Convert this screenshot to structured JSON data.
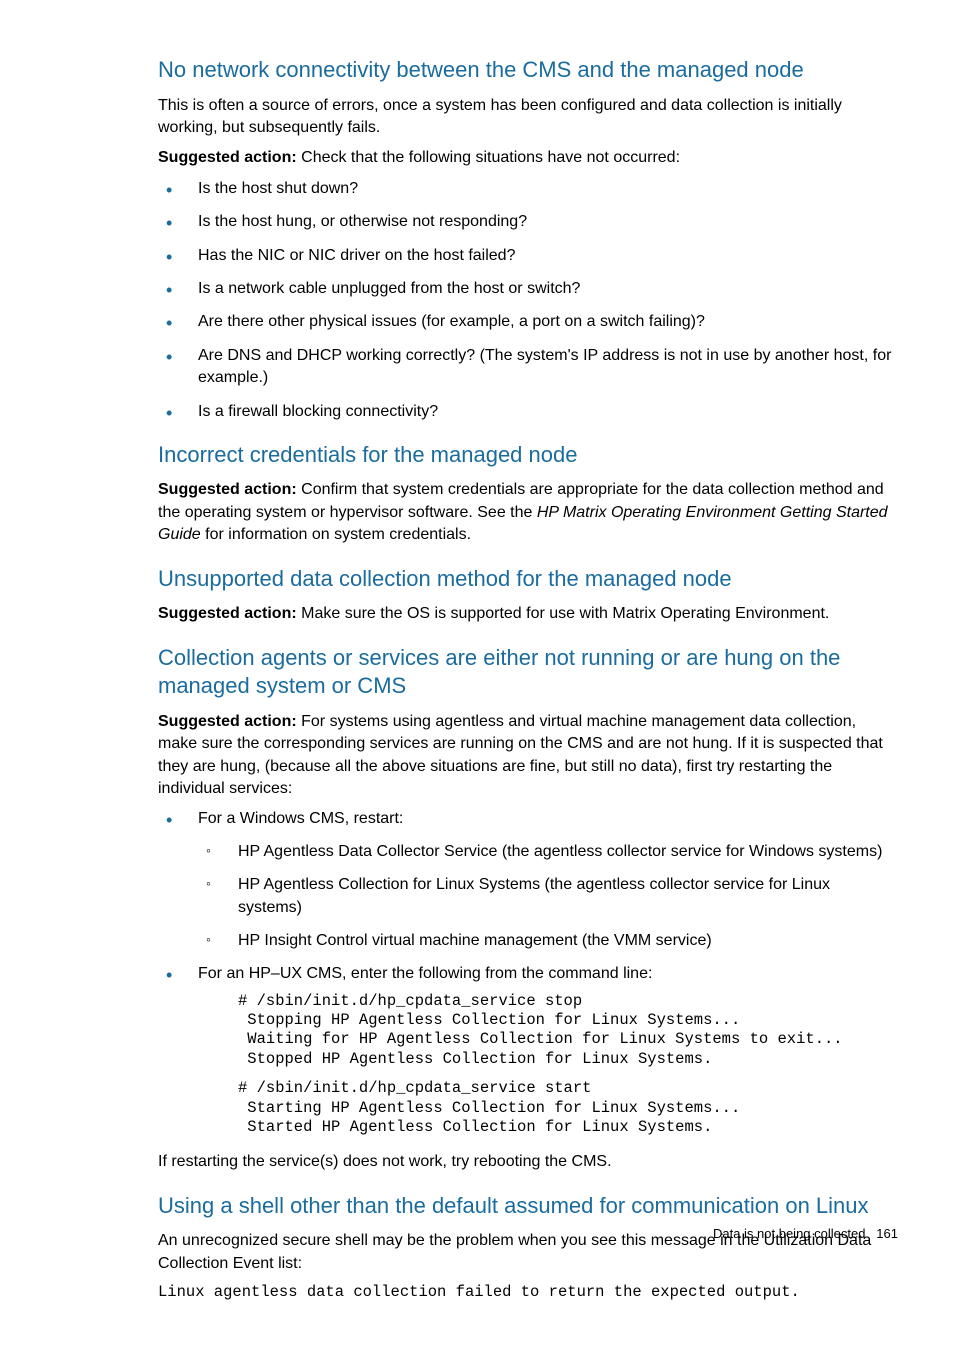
{
  "sections": [
    {
      "heading": "No network connectivity between the CMS and the managed node",
      "intro": "This is often a source of errors, once a system has been configured and data collection is initially working, but subsequently fails.",
      "action_prefix": "Suggested action:",
      "action_text": " Check that the following situations have not occurred:",
      "bullets": [
        "Is the host shut down?",
        "Is the host hung, or otherwise not responding?",
        "Has the NIC or NIC driver on the host failed?",
        "Is a network cable unplugged from the host or switch?",
        "Are there other physical issues (for example, a port on a switch failing)?",
        "Are DNS and DHCP working correctly? (The system's IP address is not in use by another host, for example.)",
        "Is a firewall blocking connectivity?"
      ]
    },
    {
      "heading": "Incorrect credentials for the managed node",
      "action_prefix": "Suggested action:",
      "action_parts": {
        "p1": " Confirm that system credentials are appropriate for the data collection method and the operating system or hypervisor software. See the ",
        "italic": "HP Matrix Operating Environment Getting Started Guide",
        "p2": " for information on system credentials."
      }
    },
    {
      "heading": "Unsupported data collection method for the managed node",
      "action_prefix": "Suggested action:",
      "action_text": " Make sure the OS is supported for use with Matrix Operating Environment."
    },
    {
      "heading": "Collection agents or services are either not running or are hung on the managed system or CMS",
      "action_prefix": "Suggested action:",
      "action_text": " For systems using agentless and virtual machine management data collection, make sure the corresponding services are running on the CMS and are not hung. If it is suspected that they are hung, (because all the above situations are fine, but still no data), first try restarting the individual services:",
      "nested": {
        "item1": {
          "text": "For a Windows CMS, restart:",
          "sub": [
            "HP Agentless Data Collector Service (the agentless collector service for Windows systems)",
            "HP Agentless Collection for Linux Systems (the agentless collector service for Linux systems)",
            "HP Insight Control virtual machine management (the VMM service)"
          ]
        },
        "item2": {
          "text": "For an HP–UX CMS, enter the following from the command line:",
          "code1": "# /sbin/init.d/hp_cpdata_service stop\n Stopping HP Agentless Collection for Linux Systems...\n Waiting for HP Agentless Collection for Linux Systems to exit...\n Stopped HP Agentless Collection for Linux Systems.",
          "code2": "# /sbin/init.d/hp_cpdata_service start\n Starting HP Agentless Collection for Linux Systems...\n Started HP Agentless Collection for Linux Systems."
        }
      },
      "closing": "If restarting the service(s) does not work, try rebooting the CMS."
    },
    {
      "heading": "Using a shell other than the default assumed for communication on Linux",
      "intro": "An unrecognized secure shell may be the problem when you see this message in the Utilization Data Collection Event list:",
      "code": "Linux agentless data collection failed to return the expected output."
    }
  ],
  "footer": {
    "title": "Data is not being collected",
    "page": "161"
  }
}
